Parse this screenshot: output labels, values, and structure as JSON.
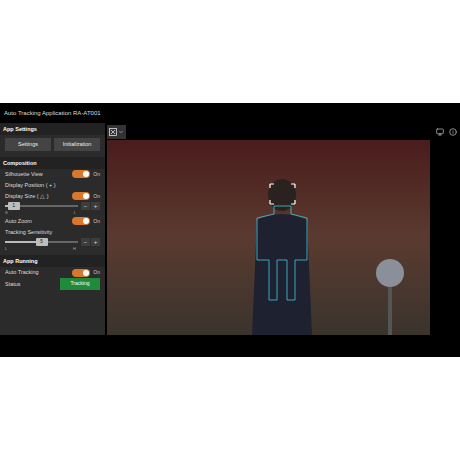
{
  "window": {
    "title": "Auto Tracking Application RA-AT001"
  },
  "app_settings": {
    "heading": "App Settings",
    "buttons": [
      "Settings",
      "Initialization"
    ]
  },
  "composition": {
    "heading": "Composition",
    "rows": [
      {
        "kind": "toggle",
        "label": "Silhouette View",
        "on": true,
        "reading": "On"
      },
      {
        "kind": "label",
        "label": "Display Position ( + )"
      },
      {
        "kind": "toggle",
        "label": "Display Size ( △ )",
        "on": true,
        "reading": "On"
      },
      {
        "kind": "slider",
        "value": "1",
        "level": 0.12,
        "min_label": "S",
        "max_label": "L",
        "minus": "−",
        "plus": "+"
      },
      {
        "kind": "toggle",
        "label": "Auto Zoom",
        "on": true,
        "reading": "On"
      },
      {
        "kind": "label",
        "label": "Tracking Sensitivity"
      },
      {
        "kind": "slider",
        "value": "5",
        "level": 0.5,
        "min_label": "L",
        "max_label": "H",
        "minus": "−",
        "plus": "+"
      }
    ]
  },
  "app_running": {
    "heading": "App Running",
    "rows": [
      {
        "kind": "toggle",
        "label": "Auto Tracking",
        "on": true,
        "reading": "On"
      },
      {
        "kind": "status",
        "label": "Status",
        "badge": "Tracking"
      }
    ]
  }
}
